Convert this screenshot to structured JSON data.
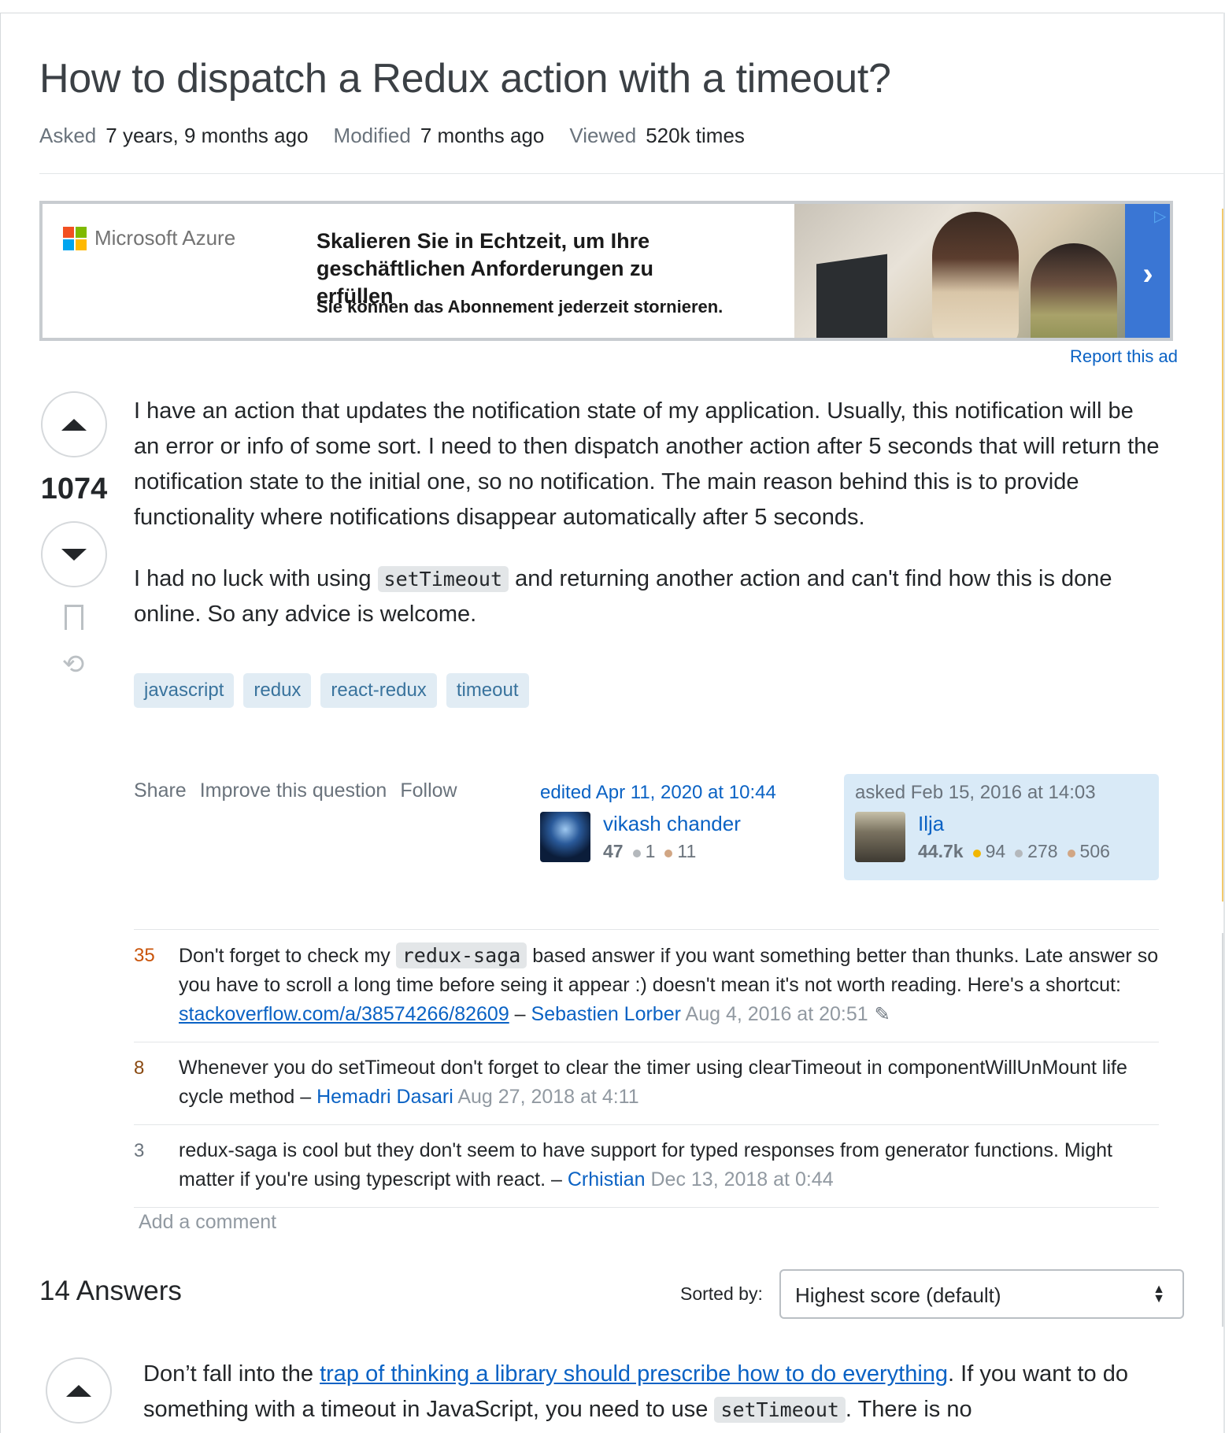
{
  "question": {
    "title": "How to dispatch a Redux action with a timeout?",
    "meta": {
      "asked_label": "Asked",
      "asked_value": "7 years, 9 months ago",
      "modified_label": "Modified",
      "modified_value": "7 months ago",
      "viewed_label": "Viewed",
      "viewed_value": "520k times"
    },
    "votes": "1074",
    "body": {
      "p1": "I have an action that updates the notification state of my application. Usually, this notification will be an error or info of some sort. I need to then dispatch another action after 5 seconds that will return the notification state to the initial one, so no notification. The main reason behind this is to provide functionality where notifications disappear automatically after 5 seconds.",
      "p2_before": "I had no luck with using ",
      "p2_code": "setTimeout",
      "p2_after": " and returning another action and can't find how this is done online. So any advice is welcome."
    },
    "tags": [
      "javascript",
      "redux",
      "react-redux",
      "timeout"
    ],
    "menu": {
      "share": "Share",
      "improve": "Improve this question",
      "follow": "Follow"
    },
    "edited": {
      "action": "edited Apr 11, 2020 at 10:44",
      "user": "vikash chander",
      "rep": "47",
      "silver": "1",
      "bronze": "11"
    },
    "asked": {
      "action": "asked Feb 15, 2016 at 14:03",
      "user": "Ilja",
      "rep": "44.7k",
      "gold": "94",
      "silver": "278",
      "bronze": "506"
    }
  },
  "ad": {
    "brand": "Microsoft Azure",
    "headline": "Skalieren Sie in Echtzeit, um Ihre geschäftlichen Anforderungen zu erfüllen",
    "subline": "Sie können das Abonnement jederzeit stornieren.",
    "cta": "›",
    "report": "Report this ad",
    "colors": {
      "red": "#f25022",
      "green": "#7fba00",
      "blue": "#00a4ef",
      "yellow": "#ffb900",
      "cta": "#3a76d4"
    }
  },
  "comments": [
    {
      "score": "35",
      "score_color": "#c9540a",
      "text_before": "Don't forget to check my ",
      "code": "redux-saga",
      "text_after": " based answer if you want something better than thunks. Late answer so you have to scroll a long time before seing it appear :) doesn't mean it's not worth reading. Here's a shortcut: ",
      "link": "stackoverflow.com/a/38574266/82609",
      "user": "Sebastien Lorber",
      "date": "Aug 4, 2016 at 20:51"
    },
    {
      "score": "8",
      "score_color": "#8a4a12",
      "text": "Whenever you do setTimeout don't forget to clear the timer using clearTimeout in componentWillUnMount life cycle method",
      "user": "Hemadri Dasari",
      "date": "Aug 27, 2018 at 4:11"
    },
    {
      "score": "3",
      "score_color": "#6a737c",
      "text": "redux-saga is cool but they don't seem to have support for typed responses from generator functions. Might matter if you're using typescript with react.",
      "user": "Crhistian",
      "date": "Dec 13, 2018 at 0:44"
    }
  ],
  "add_comment": "Add a comment",
  "answers": {
    "count_label": "14 Answers",
    "sort_label": "Sorted by:",
    "sort_value": "Highest score (default)",
    "first": {
      "before": "Don’t fall into the ",
      "link": "trap of thinking a library should prescribe how to do everything",
      "middle": ". If you want to do something with a timeout in JavaScript, you need to use ",
      "code": "setTimeout",
      "after": ". There is no"
    }
  }
}
